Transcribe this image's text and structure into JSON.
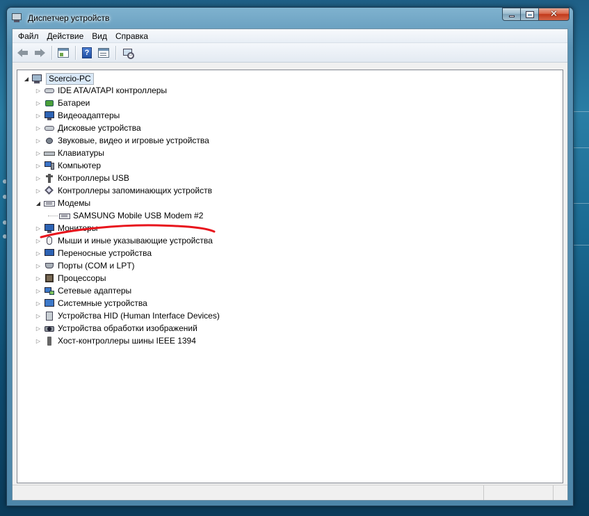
{
  "window": {
    "title": "Диспетчер устройств",
    "caption_buttons": {
      "minimize_icon": "minimize-icon",
      "maximize_icon": "maximize-icon",
      "close_icon": "close-icon"
    }
  },
  "menu": {
    "items": [
      {
        "label": "Файл"
      },
      {
        "label": "Действие"
      },
      {
        "label": "Вид"
      },
      {
        "label": "Справка"
      }
    ]
  },
  "toolbar": {
    "buttons": [
      {
        "icon": "back-arrow-icon"
      },
      {
        "icon": "forward-arrow-icon"
      },
      {
        "icon": "properties-icon"
      },
      {
        "icon": "help-icon",
        "glyph": "?"
      },
      {
        "icon": "view-icon"
      },
      {
        "icon": "scan-hardware-icon"
      }
    ]
  },
  "tree": {
    "root": {
      "label": "Scercio-PC",
      "expanded": true,
      "icon": "computer-icon"
    },
    "categories": [
      {
        "label": "IDE ATA/ATAPI контроллеры",
        "icon": "ide-controller-icon"
      },
      {
        "label": "Батареи",
        "icon": "battery-icon"
      },
      {
        "label": "Видеоадаптеры",
        "icon": "display-adapter-icon"
      },
      {
        "label": "Дисковые устройства",
        "icon": "disk-drive-icon"
      },
      {
        "label": "Звуковые, видео и игровые устройства",
        "icon": "sound-icon"
      },
      {
        "label": "Клавиатуры",
        "icon": "keyboard-icon"
      },
      {
        "label": "Компьютер",
        "icon": "computer-icon"
      },
      {
        "label": "Контроллеры USB",
        "icon": "usb-icon"
      },
      {
        "label": "Контроллеры запоминающих устройств",
        "icon": "storage-controller-icon"
      },
      {
        "label": "Модемы",
        "icon": "modem-icon",
        "expanded": true,
        "children": [
          {
            "label": "SAMSUNG Mobile USB Modem #2",
            "icon": "modem-icon"
          }
        ]
      },
      {
        "label": "Мониторы",
        "icon": "monitor-icon"
      },
      {
        "label": "Мыши и иные указывающие устройства",
        "icon": "mouse-icon"
      },
      {
        "label": "Переносные устройства",
        "icon": "portable-device-icon"
      },
      {
        "label": "Порты (COM и LPT)",
        "icon": "port-icon"
      },
      {
        "label": "Процессоры",
        "icon": "processor-icon"
      },
      {
        "label": "Сетевые адаптеры",
        "icon": "network-adapter-icon"
      },
      {
        "label": "Системные устройства",
        "icon": "system-device-icon"
      },
      {
        "label": "Устройства HID (Human Interface Devices)",
        "icon": "hid-icon"
      },
      {
        "label": "Устройства обработки изображений",
        "icon": "imaging-device-icon"
      },
      {
        "label": "Хост-контроллеры шины IEEE 1394",
        "icon": "ieee1394-icon"
      }
    ]
  },
  "annotation": {
    "color": "#e8141c",
    "type": "red-underline"
  }
}
